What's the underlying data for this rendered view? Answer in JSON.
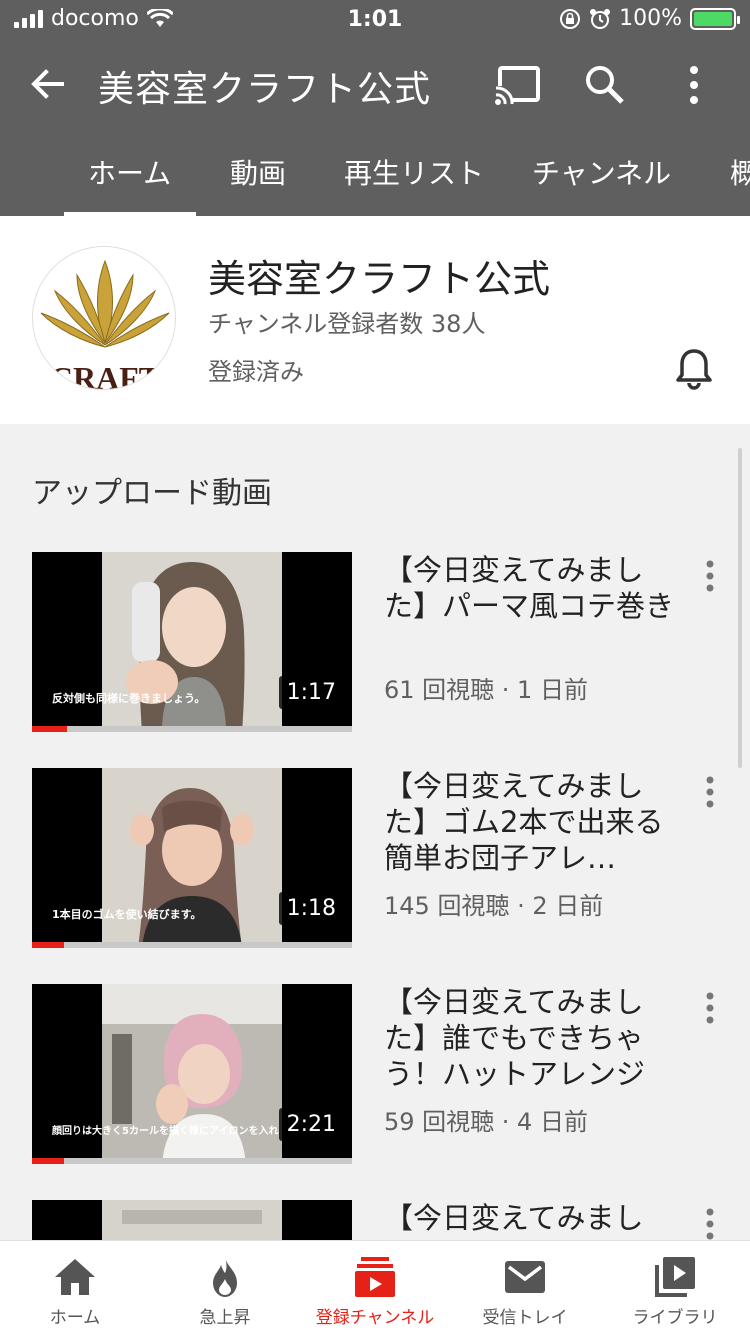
{
  "status_bar": {
    "carrier": "docomo",
    "time": "1:01",
    "battery": "100%"
  },
  "app_bar": {
    "title": "美容室クラフト公式"
  },
  "tabs": [
    {
      "label": "ホーム",
      "active": true
    },
    {
      "label": "動画"
    },
    {
      "label": "再生リスト"
    },
    {
      "label": "チャンネル"
    },
    {
      "label": "概"
    }
  ],
  "channel": {
    "name": "美容室クラフト公式",
    "subscribers": "チャンネル登録者数 38人",
    "subscribe_state": "登録済み",
    "logo_text": "CRAFT"
  },
  "uploads": {
    "section_title": "アップロード動画",
    "videos": [
      {
        "title": "【今日変えてみました】パーマ風コテ巻き",
        "meta": "61 回視聴 · 1 日前",
        "duration": "1:17",
        "caption": "反対側も同様に巻きましょう。",
        "progress": 0.11
      },
      {
        "title": "【今日変えてみました】ゴム2本で出来る簡単お団子アレ…",
        "meta": "145 回視聴 · 2 日前",
        "duration": "1:18",
        "caption": "1本目のゴムを使い結びます。",
        "progress": 0.1
      },
      {
        "title": "【今日変えてみました】誰でもできちゃう！ハットアレンジ",
        "meta": "59 回視聴 · 4 日前",
        "duration": "2:21",
        "caption": "顔回りは大きく5カールを描く様にアイロンを入れ",
        "progress": 0.1
      },
      {
        "title": "【今日変えてみまし",
        "meta": "",
        "duration": "",
        "caption": "",
        "progress": 0
      }
    ]
  },
  "bottom_nav": [
    {
      "label": "ホーム",
      "icon": "home-icon"
    },
    {
      "label": "急上昇",
      "icon": "flame-icon"
    },
    {
      "label": "登録チャンネル",
      "icon": "subscriptions-icon",
      "active": true
    },
    {
      "label": "受信トレイ",
      "icon": "mail-icon"
    },
    {
      "label": "ライブラリ",
      "icon": "library-icon"
    }
  ],
  "colors": {
    "app_bar": "#5f5f5f",
    "accent": "#e62117"
  }
}
